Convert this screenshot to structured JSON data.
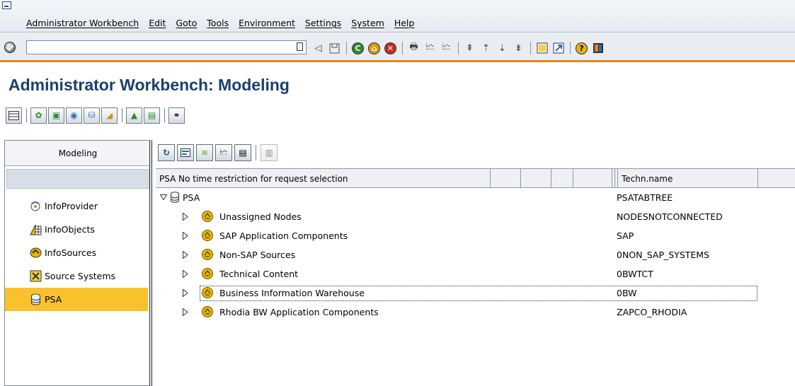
{
  "menu": {
    "items": [
      "Administrator Workbench",
      "Edit",
      "Goto",
      "Tools",
      "Environment",
      "Settings",
      "System",
      "Help"
    ]
  },
  "toolbar": {
    "command_value": "",
    "ok_icon": "enter-icon",
    "icons": [
      "back-icon",
      "save-icon",
      "back-green-icon",
      "exit-icon",
      "cancel-icon",
      "print-icon",
      "find-icon",
      "find-next-icon",
      "first-page-icon",
      "previous-page-icon",
      "next-page-icon",
      "last-page-icon",
      "create-session-icon",
      "shortcut-icon",
      "help-icon",
      "customize-layout-icon"
    ]
  },
  "page": {
    "title": "Administrator Workbench: Modeling"
  },
  "navigator": {
    "header": "Modeling",
    "items": [
      {
        "label": "InfoProvider",
        "icon": "infoprovider-icon",
        "selected": false
      },
      {
        "label": "InfoObjects",
        "icon": "infoobjects-icon",
        "selected": false
      },
      {
        "label": "InfoSources",
        "icon": "infosources-icon",
        "selected": false
      },
      {
        "label": "Source Systems",
        "icon": "source-systems-icon",
        "selected": false
      },
      {
        "label": "PSA",
        "icon": "psa-icon",
        "selected": true
      }
    ]
  },
  "tree": {
    "columns": {
      "main": "PSA No time restriction for request selection",
      "tech": "Techn.name"
    },
    "root": {
      "label": "PSA",
      "tech": "PSATABTREE"
    },
    "nodes": [
      {
        "label": "Unassigned Nodes",
        "tech": "NODESNOTCONNECTED"
      },
      {
        "label": "SAP Application Components",
        "tech": "SAP"
      },
      {
        "label": "Non-SAP Sources",
        "tech": "0NON_SAP_SYSTEMS"
      },
      {
        "label": "Technical Content",
        "tech": "0BWTCT"
      },
      {
        "label": "Business Information Warehouse",
        "tech": "0BW"
      },
      {
        "label": "Rhodia BW Application Components",
        "tech": "ZAPCO_RHODIA"
      }
    ]
  },
  "colors": {
    "title": "#1a3f6f",
    "selected_nav": "#f9c12c",
    "toolbar_accent": "#e0861a"
  }
}
